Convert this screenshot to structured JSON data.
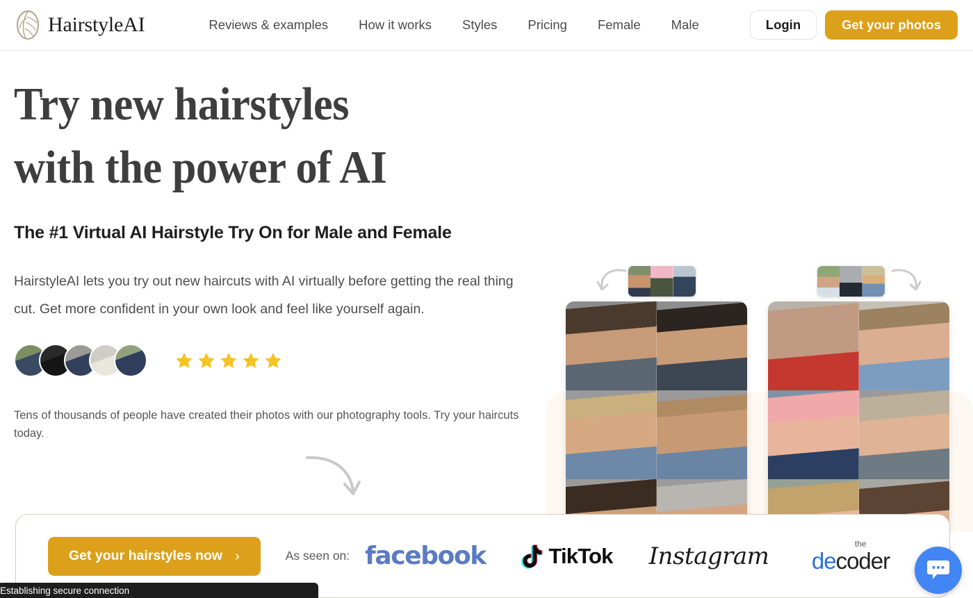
{
  "nav": {
    "brand": "HairstyleAI",
    "brand_icon": "leaf-logo-icon",
    "links": [
      {
        "label": "Reviews & examples"
      },
      {
        "label": "How it works"
      },
      {
        "label": "Styles"
      },
      {
        "label": "Pricing"
      },
      {
        "label": "Female"
      },
      {
        "label": "Male"
      }
    ],
    "login_label": "Login",
    "cta_label": "Get your photos"
  },
  "hero": {
    "headline_line1": "Try new hairstyles",
    "headline_line2": "with the power of AI",
    "subheadline": "The #1 Virtual AI Hairstyle Try On for Male and Female",
    "body": "HairstyleAI lets you try out new haircuts with AI virtually before getting the real thing cut. Get more confident in your own look and feel like yourself again.",
    "small_copy": "Tens of thousands of people have created their photos with our photography tools. Try your haircuts today.",
    "rating_stars": 5,
    "avatars_count": 5,
    "arrow_icon": "curved-down-arrow-icon"
  },
  "cta_bar": {
    "button_label": "Get your hairstyles now",
    "button_chevron": "›",
    "as_seen_label": "As seen on:",
    "logos": [
      {
        "name": "facebook",
        "text": "facebook"
      },
      {
        "name": "tiktok",
        "text": "TikTok"
      },
      {
        "name": "instagram",
        "text": "Instagram"
      },
      {
        "name": "decoder",
        "text_small": "the",
        "text_blue": "de",
        "text_dark": "coder"
      }
    ]
  },
  "chat": {
    "icon": "chat-bubble-icon",
    "color": "#4285f4"
  },
  "toast": {
    "message": "Establishing secure connection"
  },
  "colors": {
    "accent_amber": "#dda01a",
    "star_gold": "#f5c322",
    "cream_panel": "#fdf8f1",
    "cta_border": "#d8cbb9",
    "heading_gray": "#3e3e3e",
    "chat_blue": "#4285f4",
    "facebook_blue": "#5b7bc4",
    "decoder_blue": "#2b6fe0"
  }
}
